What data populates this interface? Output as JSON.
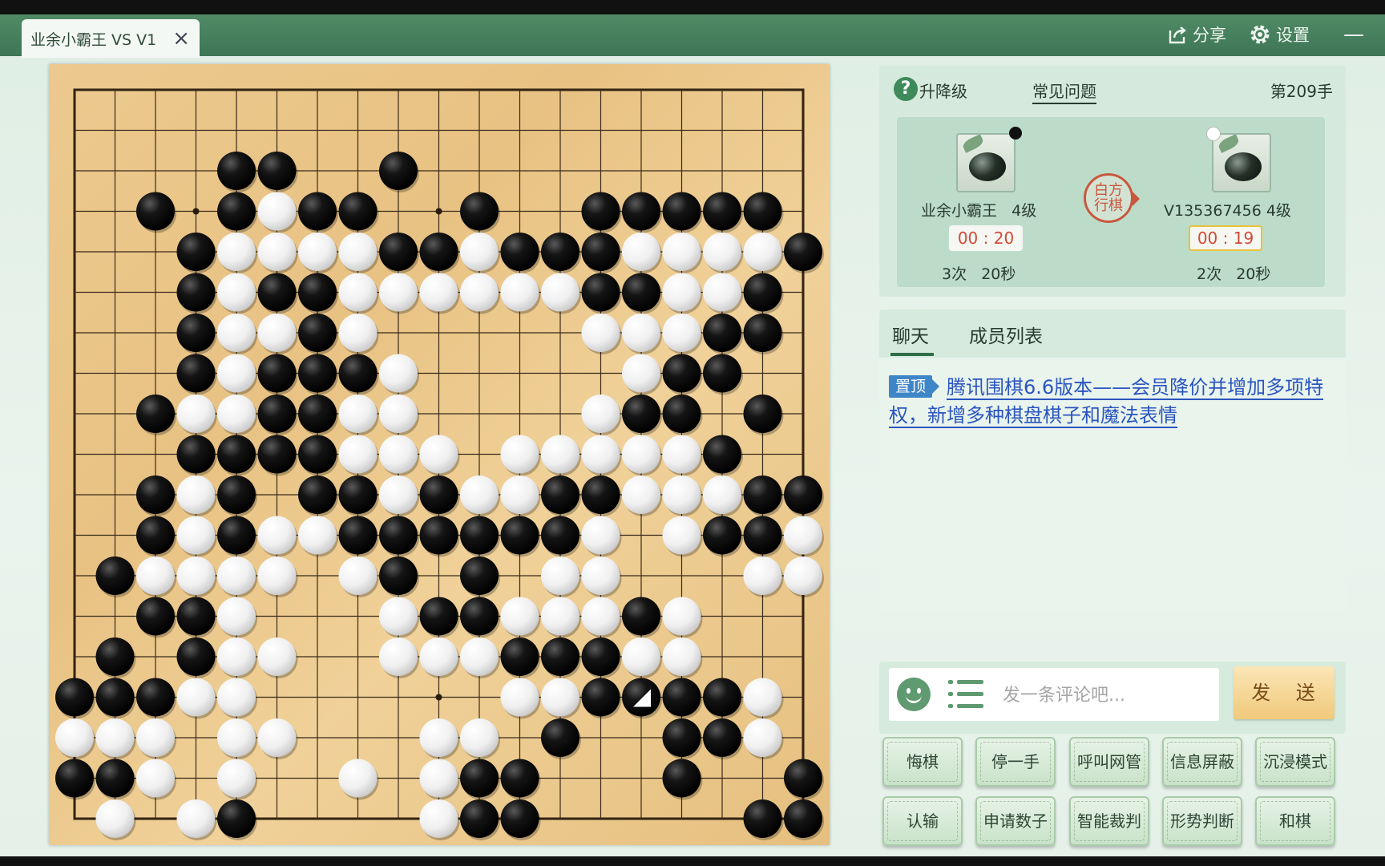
{
  "window": {
    "tab_title": "业余小霸王 VS V1",
    "share_label": "分享",
    "settings_label": "设置",
    "minimize_label": "—"
  },
  "info": {
    "rank_label": "升降级",
    "faq_label": "常见问题",
    "move_count": "第209手",
    "black": {
      "name": "业余小霸王",
      "rank": "4级",
      "timer": "00 : 20",
      "byoyomi_count": "3次",
      "byoyomi_time": "20秒"
    },
    "white": {
      "name": "V135367456",
      "rank": "4级",
      "timer": "00 : 19",
      "byoyomi_count": "2次",
      "byoyomi_time": "20秒"
    },
    "turn_seal_line1": "白方",
    "turn_seal_line2": "行棋"
  },
  "chat": {
    "tab_chat": "聊天",
    "tab_members": "成员列表",
    "pin_badge": "置顶",
    "announcement": "腾讯围棋6.6版本——会员降价并增加多项特权，新增多种棋盘棋子和魔法表情",
    "input_placeholder": "发一条评论吧...",
    "send_label": "发 送"
  },
  "actions": {
    "row1": [
      "悔棋",
      "停一手",
      "呼叫网管",
      "信息屏蔽",
      "沉浸模式"
    ],
    "row2": [
      "认输",
      "申请数子",
      "智能裁判",
      "形势判断",
      "和棋"
    ]
  },
  "board": {
    "size": 19,
    "star_points": [
      [
        3,
        3
      ],
      [
        3,
        9
      ],
      [
        3,
        15
      ],
      [
        9,
        3
      ],
      [
        9,
        9
      ],
      [
        9,
        15
      ],
      [
        15,
        3
      ],
      [
        15,
        9
      ],
      [
        15,
        15
      ]
    ],
    "last_move": [
      15,
      14
    ],
    "rows": [
      "...................",
      "...................",
      "....BB..B..........",
      "..B.BWBB..B..BBBBB.",
      "...BWWWWBBWBBBWWWWB",
      "...BWBBWWWWWWBBWWB.",
      "...BWWBW.....WWWBB.",
      "...BWBBBW.....WBB..",
      "..BWWBBWW....WBB.B.",
      "...BBBBWWW.WWWWWB..",
      "..BWB.BBWBWWBBWWWBB",
      "..BWBWWBBBBBBW.WBBW",
      ".BWWWW.WB.B.WW...WWW",
      "..BBW...WBBWWWBW...",
      ".B.BWW..WWWBBBWW...",
      "BBBWW......WWBBBBW.",
      "WWW.WW...WW.B..BBW.",
      "BBW.W..W.WBB...B..BW",
      ".W.WB....WBB.....BBW"
    ]
  }
}
